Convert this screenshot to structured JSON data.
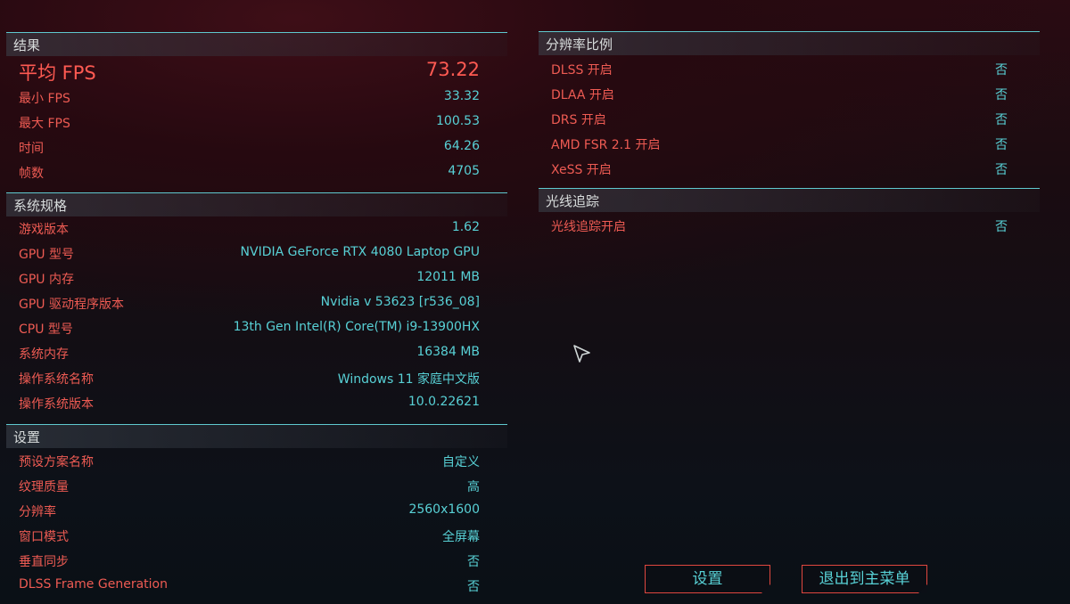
{
  "results": {
    "title": "结果",
    "avg_fps": {
      "label": "平均 FPS",
      "value": "73.22"
    },
    "rows": [
      {
        "label": "最小 FPS",
        "value": "33.32"
      },
      {
        "label": "最大 FPS",
        "value": "100.53"
      },
      {
        "label": "时间",
        "value": "64.26"
      },
      {
        "label": "帧数",
        "value": "4705"
      }
    ]
  },
  "system_specs": {
    "title": "系统规格",
    "rows": [
      {
        "label": "游戏版本",
        "value": "1.62"
      },
      {
        "label": "GPU 型号",
        "value": "NVIDIA GeForce RTX 4080 Laptop GPU"
      },
      {
        "label": "GPU 内存",
        "value": "12011 MB"
      },
      {
        "label": "GPU 驱动程序版本",
        "value": "Nvidia v 53623 [r536_08]"
      },
      {
        "label": "CPU 型号",
        "value": "13th Gen Intel(R) Core(TM) i9-13900HX"
      },
      {
        "label": "系统内存",
        "value": "16384 MB"
      },
      {
        "label": "操作系统名称",
        "value": "Windows 11 家庭中文版"
      },
      {
        "label": "操作系统版本",
        "value": "10.0.22621"
      }
    ]
  },
  "settings": {
    "title": "设置",
    "rows": [
      {
        "label": "预设方案名称",
        "value": "自定义"
      },
      {
        "label": "纹理质量",
        "value": "高"
      },
      {
        "label": "分辨率",
        "value": "2560x1600"
      },
      {
        "label": "窗口模式",
        "value": "全屏幕"
      },
      {
        "label": "垂直同步",
        "value": "否"
      },
      {
        "label": "DLSS Frame Generation",
        "value": "否"
      }
    ]
  },
  "resolution_scaling": {
    "title": "分辨率比例",
    "rows": [
      {
        "label": "DLSS 开启",
        "value": "否"
      },
      {
        "label": "DLAA 开启",
        "value": "否"
      },
      {
        "label": "DRS 开启",
        "value": "否"
      },
      {
        "label": "AMD FSR 2.1 开启",
        "value": "否"
      },
      {
        "label": "XeSS 开启",
        "value": "否"
      }
    ]
  },
  "ray_tracing": {
    "title": "光线追踪",
    "rows": [
      {
        "label": "光线追踪开启",
        "value": "否"
      }
    ]
  },
  "buttons": {
    "settings": "设置",
    "exit_main_menu": "退出到主菜单"
  },
  "colors": {
    "accent_red": "#ee5b53",
    "accent_cyan": "#58d1d6",
    "divider_cyan": "#5fc9cf"
  },
  "icons": {
    "cursor": "pointer-cursor-icon"
  }
}
